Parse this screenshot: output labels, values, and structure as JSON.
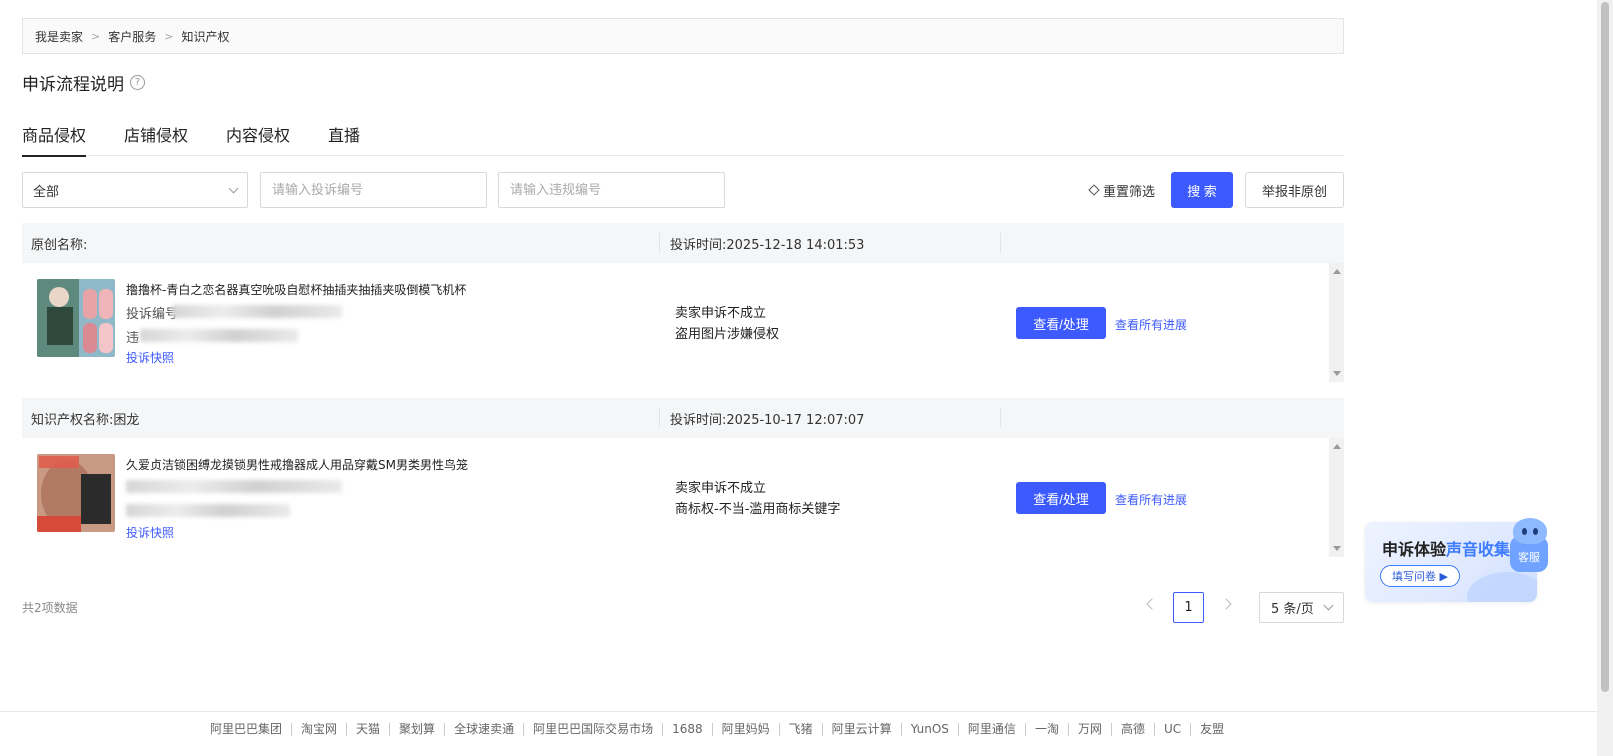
{
  "breadcrumb": [
    "我是卖家",
    "客户服务",
    "知识产权"
  ],
  "page_title": "申诉流程说明",
  "help_icon_glyph": "?",
  "tabs": [
    "商品侵权",
    "店铺侵权",
    "内容侵权",
    "直播"
  ],
  "active_tab": "商品侵权",
  "filters": {
    "select_value": "全部",
    "complaint_placeholder": "请输入投诉编号",
    "violation_placeholder": "请输入违规编号",
    "reset_label": "重置筛选",
    "search_label": "搜 索",
    "report_label": "举报非原创"
  },
  "records": [
    {
      "header_left": "原创名称:",
      "header_time": "投诉时间:2025-12-18 14:01:53",
      "product_title": "撸撸杯-青白之恋名器真空吮吸自慰杯抽插夹抽插夹吸倒模飞机杯",
      "blur_prefix_1": "投诉编号",
      "blur_prefix_2": "违",
      "snapshot_link": "投诉快照",
      "status_line_1": "卖家申诉不成立",
      "status_line_2": "盗用图片涉嫌侵权",
      "view_label": "查看/处理",
      "progress_label": "查看所有进展"
    },
    {
      "header_left": "知识产权名称:困龙",
      "header_time": "投诉时间:2025-10-17 12:07:07",
      "product_title": "久爱贞洁锁困缚龙摸锁男性戒撸器成人用品穿戴SM男类男性鸟笼",
      "blur_prefix_1": "",
      "blur_prefix_2": "",
      "snapshot_link": "投诉快照",
      "status_line_1": "卖家申诉不成立",
      "status_line_2": "商标权-不当-滥用商标关键字",
      "view_label": "查看/处理",
      "progress_label": "查看所有进展"
    }
  ],
  "pagination": {
    "total": "共2项数据",
    "current_page": "1",
    "page_size": "5 条/页"
  },
  "survey": {
    "title_a": "申诉体验",
    "title_b": "声音收集",
    "button": "填写问卷 ▶"
  },
  "kefu_label": "客服",
  "footer_links": [
    "阿里巴巴集团",
    "淘宝网",
    "天猫",
    "聚划算",
    "全球速卖通",
    "阿里巴巴国际交易市场",
    "1688",
    "阿里妈妈",
    "飞猪",
    "阿里云计算",
    "YunOS",
    "阿里通信",
    "一淘",
    "万网",
    "高德",
    "UC",
    "友盟"
  ],
  "colors": {
    "primary": "#3d5afe",
    "header_bg": "#f5f6f7"
  }
}
